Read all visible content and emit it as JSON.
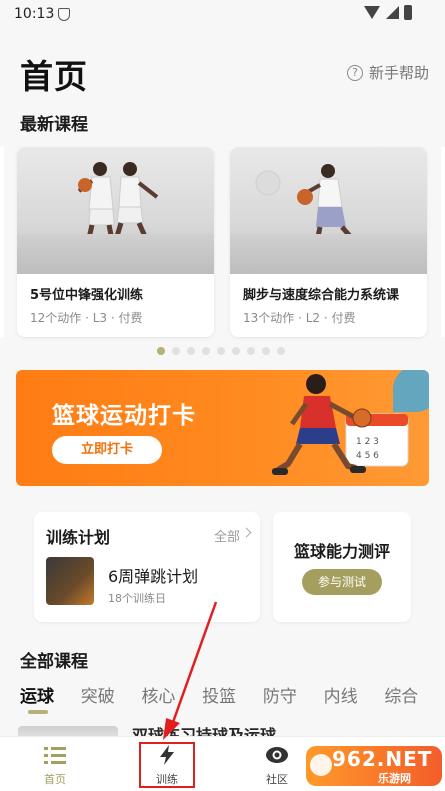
{
  "status_bar": {
    "time": "10:13"
  },
  "header": {
    "title": "首页",
    "help_label": "新手帮助"
  },
  "latest_courses": {
    "title": "最新课程",
    "cards": [
      {
        "name": "5号位中锋强化训练",
        "meta": "12个动作 · L3 · 付费"
      },
      {
        "name": "脚步与速度综合能力系统课",
        "meta": "13个动作 · L2 · 付费"
      }
    ],
    "pager": {
      "count": 9,
      "active_index": 0
    }
  },
  "banner": {
    "title": "篮球运动打卡",
    "button_label": "立即打卡"
  },
  "training_plan": {
    "title": "训练计划",
    "all_label": "全部",
    "plan_name": "6周弹跳计划",
    "plan_days": "18个训练日"
  },
  "assessment": {
    "title": "篮球能力测评",
    "button_label": "参与测试"
  },
  "all_courses": {
    "title": "全部课程",
    "tabs": [
      "运球",
      "突破",
      "核心",
      "投篮",
      "防守",
      "内线",
      "综合"
    ],
    "active_tab": "运球",
    "peek_text": "双球练习持球及运球"
  },
  "bottom_nav": {
    "items": [
      {
        "label": "首页",
        "icon": "list-icon"
      },
      {
        "label": "训练",
        "icon": "lightning-icon"
      },
      {
        "label": "社区",
        "icon": "eye-icon"
      }
    ],
    "active": "首页"
  },
  "watermark": {
    "main": "962.NET",
    "sub": "乐游网"
  },
  "colors": {
    "accent": "#b7b07a",
    "banner_orange": "#ff8a1f",
    "highlight_red": "#e02020"
  }
}
